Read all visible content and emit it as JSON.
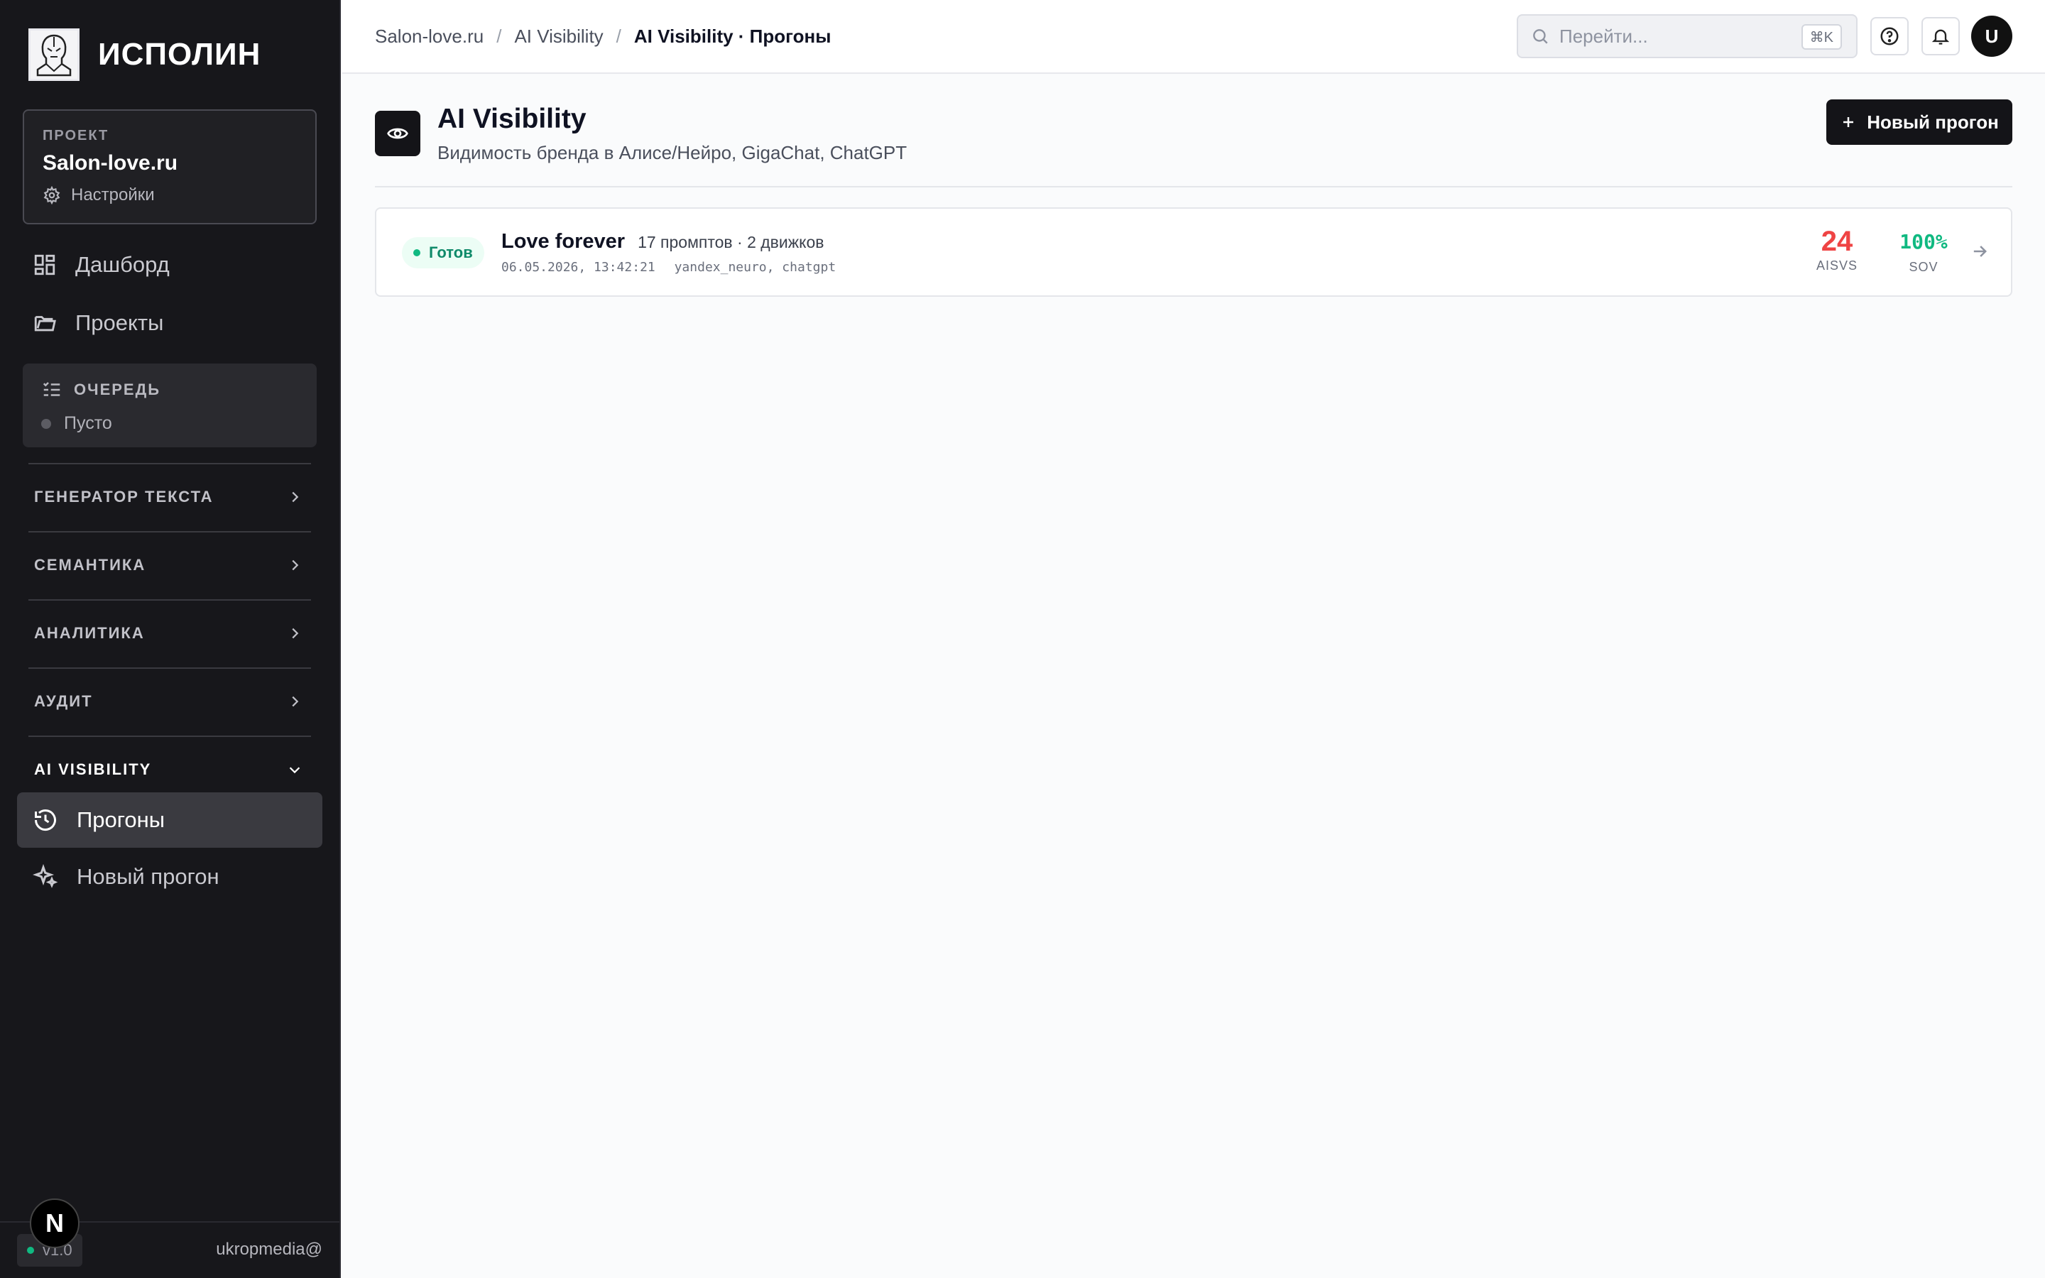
{
  "brand": {
    "name": "ИСПОЛИН"
  },
  "project": {
    "kicker": "ПРОЕКТ",
    "name": "Salon-love.ru",
    "settings": "Настройки"
  },
  "nav": {
    "dashboard": "Дашборд",
    "projects": "Проекты"
  },
  "queue": {
    "title": "ОЧЕРЕДЬ",
    "status": "Пусто"
  },
  "sections": {
    "textgen": "ГЕНЕРАТОР ТЕКСТА",
    "semantics": "СЕМАНТИКА",
    "analytics": "АНАЛИТИКА",
    "audit": "АУДИТ",
    "aivis": "AI VISIBILITY"
  },
  "aivis_items": {
    "runs": "Прогоны",
    "new_run": "Новый прогон"
  },
  "footer": {
    "version": "v1.0",
    "user": "ukropmedia@",
    "next_badge": "N"
  },
  "breadcrumbs": {
    "project": "Salon-love.ru",
    "section": "AI Visibility",
    "current": "AI Visibility · Прогоны"
  },
  "search": {
    "placeholder": "Перейти...",
    "shortcut": "⌘K"
  },
  "user_avatar": "U",
  "page": {
    "title": "AI Visibility",
    "subtitle": "Видимость бренда в Алисе/Нейро, GigaChat, ChatGPT",
    "new_run_button": "Новый прогон"
  },
  "runs": [
    {
      "status": "Готов",
      "name": "Love forever",
      "meta": "17 промптов · 2 движков",
      "datetime": "06.05.2026, 13:42:21",
      "engines": "yandex_neuro, chatgpt",
      "aisvs_value": "24",
      "aisvs_label": "AISVS",
      "sov_value": "100%",
      "sov_label": "SOV"
    }
  ],
  "colors": {
    "accent_dark": "#141418",
    "aisvs": "#ef4444",
    "sov": "#10b981",
    "status_ok": "#0f8a6a"
  }
}
